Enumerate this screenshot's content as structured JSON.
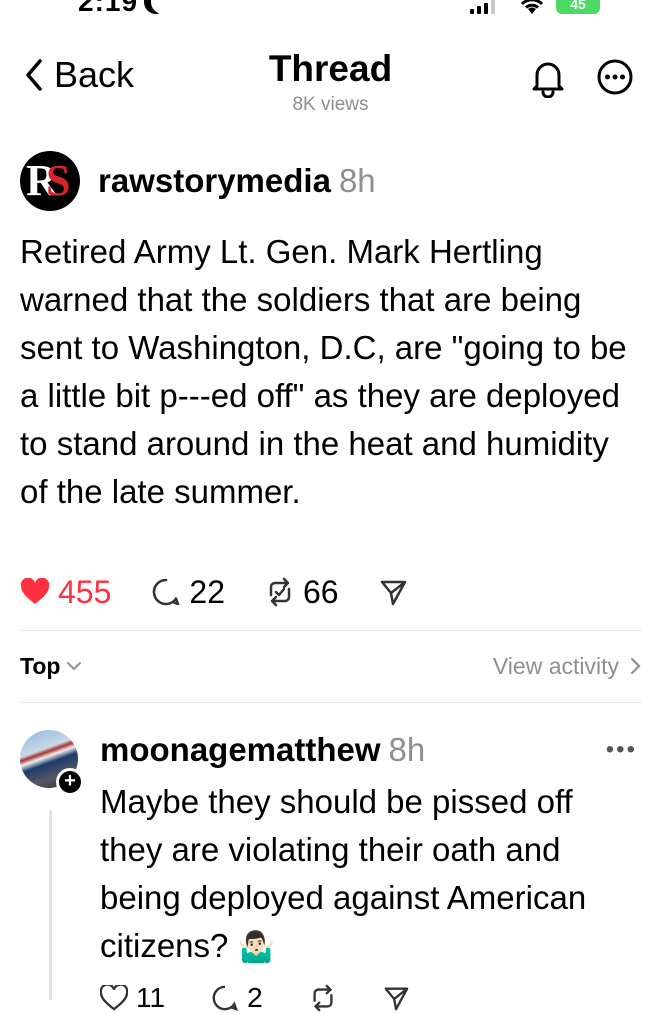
{
  "status_bar": {
    "time": "2:19",
    "battery": "45"
  },
  "header": {
    "back_label": "Back",
    "title": "Thread",
    "views": "8K views"
  },
  "post": {
    "username": "rawstorymedia",
    "time": "8h",
    "text": "Retired Army Lt. Gen. Mark Hertling warned that the soldiers that are being sent to Washington, D.C, are \"going to be a little bit p---ed off\" as they are deployed to stand around in the heat and humidity of the late summer.",
    "likes": "455",
    "replies": "22",
    "reposts": "66",
    "liked": true,
    "like_color": "#ff3040"
  },
  "sort": {
    "label": "Top",
    "view_activity": "View activity"
  },
  "reply": {
    "username": "moonagematthew",
    "time": "8h",
    "text": "Maybe they should be pissed off they are violating their oath and being deployed against American citizens?",
    "emoji": "🤷🏻‍♂️",
    "likes": "11",
    "replies": "2"
  },
  "icons": {
    "back": "chevron-left-icon",
    "bell": "bell-icon",
    "more": "more-icon",
    "heart": "heart-icon",
    "comment": "comment-icon",
    "repost": "repost-icon",
    "share": "share-icon"
  }
}
